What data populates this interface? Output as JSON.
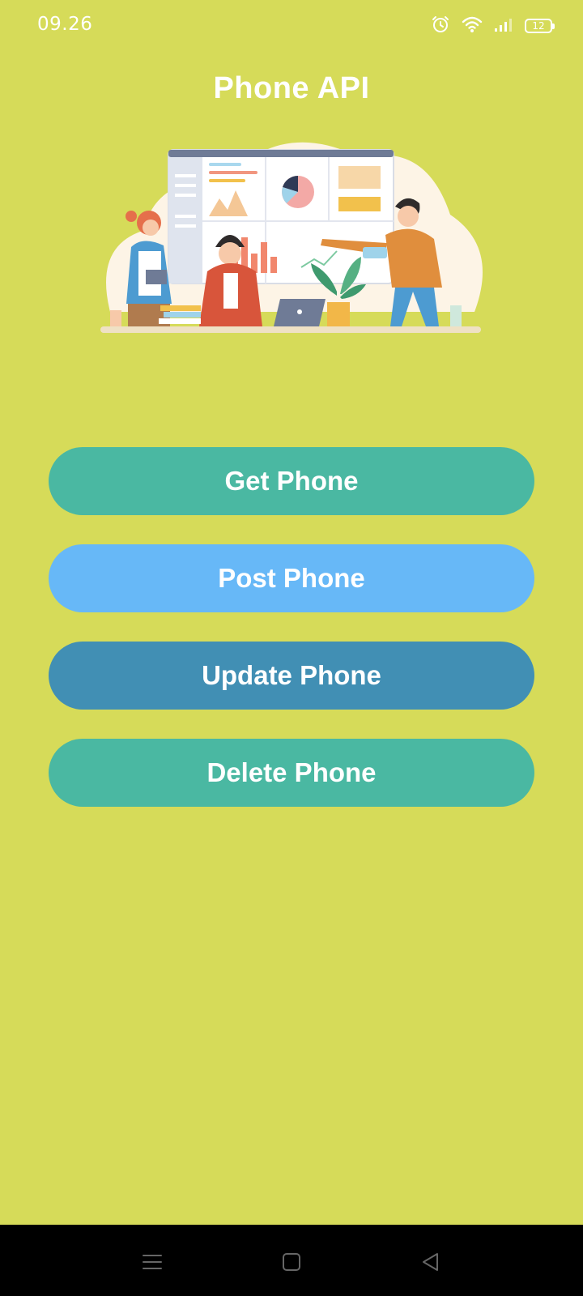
{
  "status_bar": {
    "time": "09.26",
    "battery_level": "12",
    "icons": [
      "alarm-icon",
      "wifi-icon",
      "signal-icon",
      "battery-icon"
    ]
  },
  "app": {
    "title": "Phone API"
  },
  "hero": {
    "illustration": "team-dashboard-illustration"
  },
  "buttons": {
    "get": "Get Phone",
    "post": "Post Phone",
    "update": "Update Phone",
    "delete": "Delete Phone"
  },
  "nav_bar": {
    "icons": [
      "menu-icon",
      "home-icon",
      "back-icon"
    ]
  },
  "colors": {
    "background": "#d6db59",
    "get": "#4ab8a2",
    "post": "#67b8f7",
    "update": "#418fb4",
    "delete": "#4ab8a2"
  }
}
